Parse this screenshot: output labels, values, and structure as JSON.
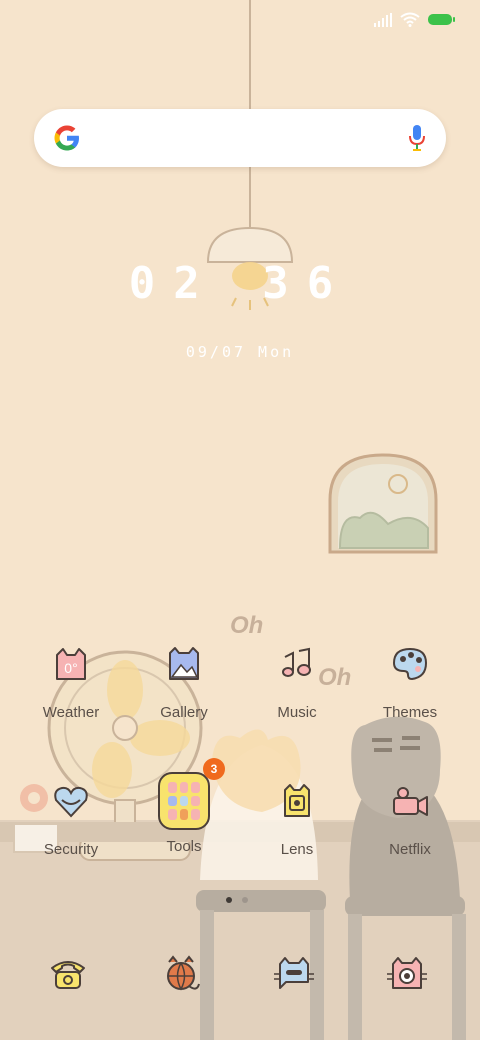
{
  "clock": {
    "time": "02 36",
    "date": "09/07 Mon"
  },
  "home": {
    "row1": [
      {
        "label": "Weather",
        "icon": "weather-icon"
      },
      {
        "label": "Gallery",
        "icon": "gallery-icon"
      },
      {
        "label": "Music",
        "icon": "music-icon"
      },
      {
        "label": "Themes",
        "icon": "themes-icon"
      }
    ],
    "row2": [
      {
        "label": "Security",
        "icon": "security-icon"
      },
      {
        "label": "Tools",
        "icon": "tools-folder-icon",
        "badge": "3"
      },
      {
        "label": "Lens",
        "icon": "lens-icon"
      },
      {
        "label": "Netflix",
        "icon": "netflix-icon"
      }
    ]
  },
  "dock": [
    "phone-icon",
    "browser-icon",
    "messages-icon",
    "camera-icon"
  ],
  "weather_icon_text": "0°",
  "wallpaper_text": [
    "Oh",
    "Oh"
  ],
  "colors": {
    "wall": "#f6e4cc",
    "floor": "#e2d1bd",
    "badge": "#f06a1d",
    "battery": "#3cc24a"
  }
}
